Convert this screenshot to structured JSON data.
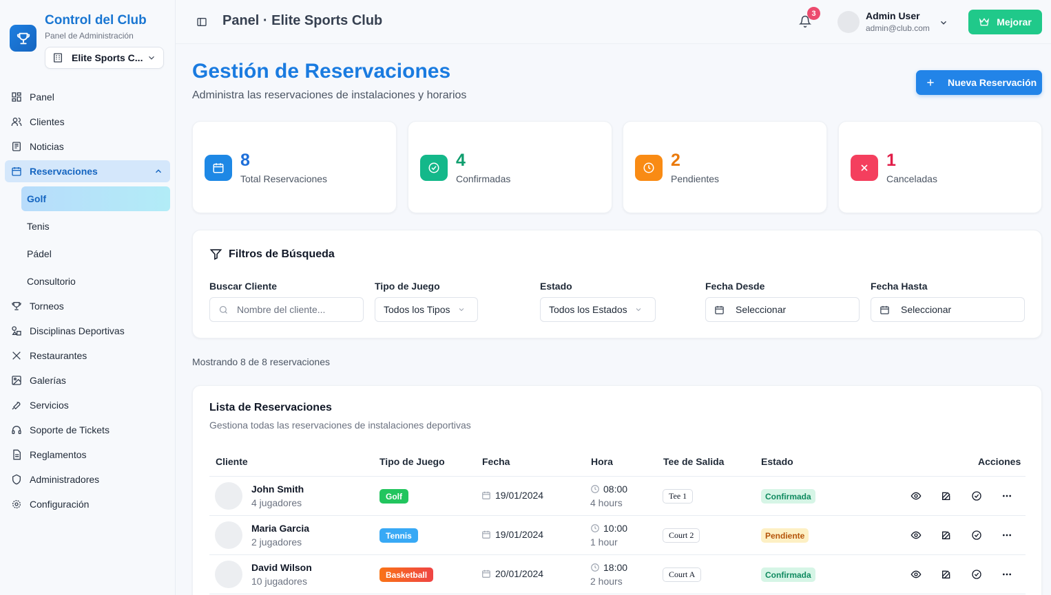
{
  "brand": {
    "title": "Control del Club",
    "subtitle": "Panel de Administración",
    "club": "Elite Sports C..."
  },
  "nav": {
    "panel": "Panel",
    "clientes": "Clientes",
    "noticias": "Noticias",
    "reservaciones": "Reservaciones",
    "sub": {
      "golf": "Golf",
      "tenis": "Tenis",
      "padel": "Pádel",
      "consultorio": "Consultorio"
    },
    "torneos": "Torneos",
    "disciplinas": "Disciplinas Deportivas",
    "restaurantes": "Restaurantes",
    "galerias": "Galerías",
    "servicios": "Servicios",
    "soporte": "Soporte de Tickets",
    "reglamentos": "Reglamentos",
    "administradores": "Administradores",
    "configuracion": "Configuración"
  },
  "header": {
    "title": "Panel · Elite Sports Club",
    "notifications": "3",
    "user_name": "Admin User",
    "user_email": "admin@club.com",
    "upgrade": "Mejorar"
  },
  "page": {
    "title": "Gestión de Reservaciones",
    "subtitle": "Administra las reservaciones de instalaciones y horarios",
    "new_button": "Nueva Reservación"
  },
  "stats": {
    "total": {
      "value": "8",
      "label": "Total Reservaciones"
    },
    "confirmed": {
      "value": "4",
      "label": "Confirmadas"
    },
    "pending": {
      "value": "2",
      "label": "Pendientes"
    },
    "cancelled": {
      "value": "1",
      "label": "Canceladas"
    }
  },
  "filters": {
    "title": "Filtros de Búsqueda",
    "client_label": "Buscar Cliente",
    "client_placeholder": "Nombre del cliente...",
    "game_label": "Tipo de Juego",
    "game_value": "Todos los Tipos",
    "status_label": "Estado",
    "status_value": "Todos los Estados",
    "from_label": "Fecha Desde",
    "from_value": "Seleccionar",
    "to_label": "Fecha Hasta",
    "to_value": "Seleccionar"
  },
  "showing": "Mostrando 8 de 8 reservaciones",
  "list": {
    "title": "Lista de Reservaciones",
    "subtitle": "Gestiona todas las reservaciones de instalaciones deportivas",
    "columns": {
      "client": "Cliente",
      "game": "Tipo de Juego",
      "date": "Fecha",
      "time": "Hora",
      "tee": "Tee de Salida",
      "status": "Estado",
      "actions": "Acciones"
    },
    "rows": [
      {
        "name": "John Smith",
        "players": "4 jugadores",
        "game": "Golf",
        "date": "19/01/2024",
        "time": "08:00",
        "duration": "4 hours",
        "tee": "Tee 1",
        "status": "Confirmada"
      },
      {
        "name": "Maria Garcia",
        "players": "2 jugadores",
        "game": "Tennis",
        "date": "19/01/2024",
        "time": "10:00",
        "duration": "1 hour",
        "tee": "Court 2",
        "status": "Pendiente"
      },
      {
        "name": "David Wilson",
        "players": "10 jugadores",
        "game": "Basketball",
        "date": "20/01/2024",
        "time": "18:00",
        "duration": "2 hours",
        "tee": "Court A",
        "status": "Confirmada"
      }
    ]
  },
  "colors": {
    "primary": "#1a7be0",
    "success": "#20c98a",
    "warning": "#f59e0b",
    "danger": "#f43f5e",
    "golf": "#22c55e",
    "tennis": "#38bdf8",
    "basketball": "#f97316"
  }
}
